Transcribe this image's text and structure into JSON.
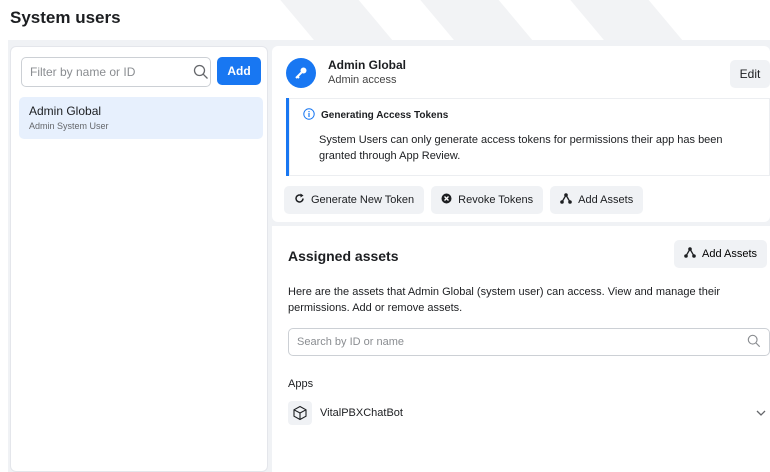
{
  "page": {
    "title": "System users"
  },
  "left": {
    "filter_placeholder": "Filter by name or ID",
    "add_label": "Add",
    "users": [
      {
        "name": "Admin Global",
        "role": "Admin System User"
      }
    ]
  },
  "header": {
    "name": "Admin Global",
    "subtitle": "Admin access",
    "edit_label": "Edit"
  },
  "notice": {
    "title": "Generating Access Tokens",
    "body": "System Users can only generate access tokens for permissions their app has been granted through App Review."
  },
  "token_actions": {
    "generate": "Generate New Token",
    "revoke": "Revoke Tokens",
    "add_assets": "Add Assets"
  },
  "assets": {
    "title": "Assigned assets",
    "add_label": "Add Assets",
    "description": "Here are the assets that Admin Global (system user) can access. View and manage their permissions. Add or remove assets.",
    "search_placeholder": "Search by ID or name",
    "apps_label": "Apps",
    "apps": [
      {
        "name": "VitalPBXChatBot"
      }
    ]
  },
  "colors": {
    "accent": "#1877f2",
    "panel_bg": "#f0f2f5"
  }
}
